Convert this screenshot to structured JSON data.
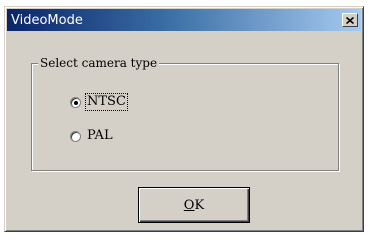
{
  "window": {
    "title": "VideoMode",
    "close_icon": "close-icon",
    "colors": {
      "face": "#d4d0c8",
      "titlebar_start": "#0a246a",
      "titlebar_end": "#a6caf0"
    }
  },
  "group": {
    "legend": "Select camera type"
  },
  "options": [
    {
      "label": "NTSC",
      "selected": true,
      "focused": true
    },
    {
      "label": "PAL",
      "selected": false,
      "focused": false
    }
  ],
  "ok_button": {
    "mnemonic": "O",
    "rest": "K"
  }
}
